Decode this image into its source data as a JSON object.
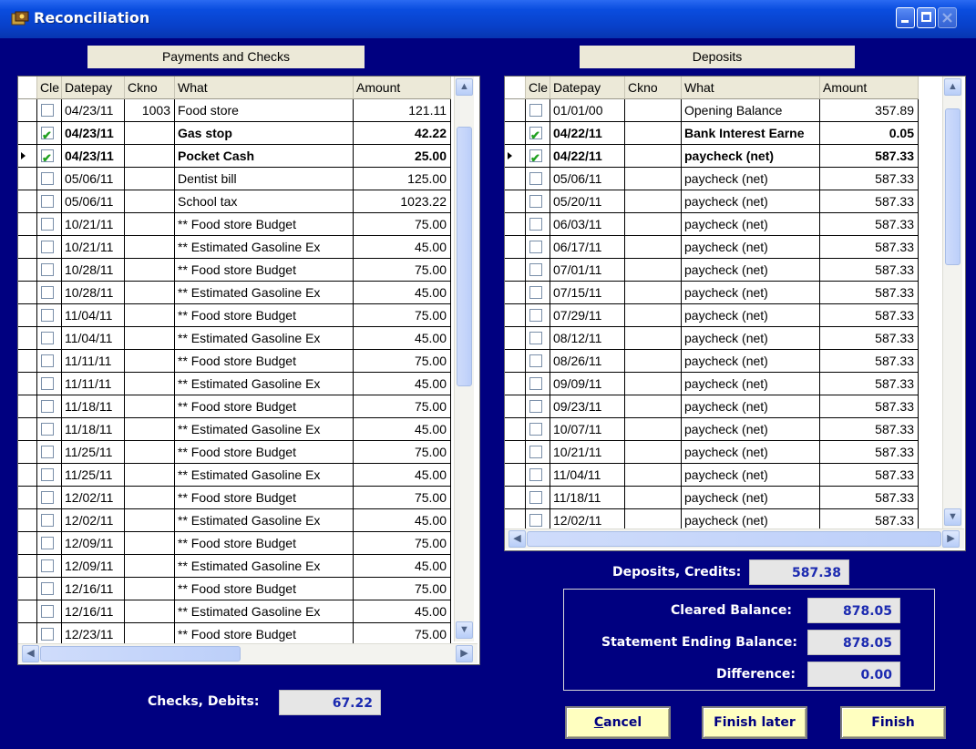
{
  "window": {
    "title": "Reconciliation",
    "icon": "reconcile-app-icon",
    "controls": [
      "minimize-icon",
      "maximize-icon",
      "close-icon"
    ]
  },
  "payments": {
    "title": "Payments and Checks",
    "headers": [
      "Cle",
      "Datepay",
      "Ckno",
      "What",
      "Amount"
    ],
    "current_row": 2,
    "rows": [
      {
        "cleared": false,
        "date": "04/23/11",
        "ckno": "1003",
        "what": "Food store",
        "amount": "121.11",
        "bold": false
      },
      {
        "cleared": true,
        "date": "04/23/11",
        "ckno": "",
        "what": "Gas stop",
        "amount": "42.22",
        "bold": true
      },
      {
        "cleared": true,
        "date": "04/23/11",
        "ckno": "",
        "what": "Pocket Cash",
        "amount": "25.00",
        "bold": true
      },
      {
        "cleared": false,
        "date": "05/06/11",
        "ckno": "",
        "what": "Dentist bill",
        "amount": "125.00",
        "bold": false
      },
      {
        "cleared": false,
        "date": "05/06/11",
        "ckno": "",
        "what": "School tax",
        "amount": "1023.22",
        "bold": false
      },
      {
        "cleared": false,
        "date": "10/21/11",
        "ckno": "",
        "what": "** Food store Budget",
        "amount": "75.00",
        "bold": false
      },
      {
        "cleared": false,
        "date": "10/21/11",
        "ckno": "",
        "what": "** Estimated Gasoline Ex",
        "amount": "45.00",
        "bold": false
      },
      {
        "cleared": false,
        "date": "10/28/11",
        "ckno": "",
        "what": "** Food store Budget",
        "amount": "75.00",
        "bold": false
      },
      {
        "cleared": false,
        "date": "10/28/11",
        "ckno": "",
        "what": "** Estimated Gasoline Ex",
        "amount": "45.00",
        "bold": false
      },
      {
        "cleared": false,
        "date": "11/04/11",
        "ckno": "",
        "what": "** Food store Budget",
        "amount": "75.00",
        "bold": false
      },
      {
        "cleared": false,
        "date": "11/04/11",
        "ckno": "",
        "what": "** Estimated Gasoline Ex",
        "amount": "45.00",
        "bold": false
      },
      {
        "cleared": false,
        "date": "11/11/11",
        "ckno": "",
        "what": "** Food store Budget",
        "amount": "75.00",
        "bold": false
      },
      {
        "cleared": false,
        "date": "11/11/11",
        "ckno": "",
        "what": "** Estimated Gasoline Ex",
        "amount": "45.00",
        "bold": false
      },
      {
        "cleared": false,
        "date": "11/18/11",
        "ckno": "",
        "what": "** Food store Budget",
        "amount": "75.00",
        "bold": false
      },
      {
        "cleared": false,
        "date": "11/18/11",
        "ckno": "",
        "what": "** Estimated Gasoline Ex",
        "amount": "45.00",
        "bold": false
      },
      {
        "cleared": false,
        "date": "11/25/11",
        "ckno": "",
        "what": "** Food store Budget",
        "amount": "75.00",
        "bold": false
      },
      {
        "cleared": false,
        "date": "11/25/11",
        "ckno": "",
        "what": "** Estimated Gasoline Ex",
        "amount": "45.00",
        "bold": false
      },
      {
        "cleared": false,
        "date": "12/02/11",
        "ckno": "",
        "what": "** Food store Budget",
        "amount": "75.00",
        "bold": false
      },
      {
        "cleared": false,
        "date": "12/02/11",
        "ckno": "",
        "what": "** Estimated Gasoline Ex",
        "amount": "45.00",
        "bold": false
      },
      {
        "cleared": false,
        "date": "12/09/11",
        "ckno": "",
        "what": "** Food store Budget",
        "amount": "75.00",
        "bold": false
      },
      {
        "cleared": false,
        "date": "12/09/11",
        "ckno": "",
        "what": "** Estimated Gasoline Ex",
        "amount": "45.00",
        "bold": false
      },
      {
        "cleared": false,
        "date": "12/16/11",
        "ckno": "",
        "what": "** Food store Budget",
        "amount": "75.00",
        "bold": false
      },
      {
        "cleared": false,
        "date": "12/16/11",
        "ckno": "",
        "what": "** Estimated Gasoline Ex",
        "amount": "45.00",
        "bold": false
      },
      {
        "cleared": false,
        "date": "12/23/11",
        "ckno": "",
        "what": "** Food store Budget",
        "amount": "75.00",
        "bold": false
      }
    ]
  },
  "deposits": {
    "title": "Deposits",
    "headers": [
      "Cle",
      "Datepay",
      "Ckno",
      "What",
      "Amount"
    ],
    "current_row": 2,
    "rows": [
      {
        "cleared": false,
        "date": "01/01/00",
        "ckno": "",
        "what": "Opening Balance",
        "amount": "357.89",
        "bold": false
      },
      {
        "cleared": true,
        "date": "04/22/11",
        "ckno": "",
        "what": "Bank Interest Earne",
        "amount": "0.05",
        "bold": true
      },
      {
        "cleared": true,
        "date": "04/22/11",
        "ckno": "",
        "what": "paycheck (net)",
        "amount": "587.33",
        "bold": true
      },
      {
        "cleared": false,
        "date": "05/06/11",
        "ckno": "",
        "what": "paycheck (net)",
        "amount": "587.33",
        "bold": false
      },
      {
        "cleared": false,
        "date": "05/20/11",
        "ckno": "",
        "what": "paycheck (net)",
        "amount": "587.33",
        "bold": false
      },
      {
        "cleared": false,
        "date": "06/03/11",
        "ckno": "",
        "what": "paycheck (net)",
        "amount": "587.33",
        "bold": false
      },
      {
        "cleared": false,
        "date": "06/17/11",
        "ckno": "",
        "what": "paycheck (net)",
        "amount": "587.33",
        "bold": false
      },
      {
        "cleared": false,
        "date": "07/01/11",
        "ckno": "",
        "what": "paycheck (net)",
        "amount": "587.33",
        "bold": false
      },
      {
        "cleared": false,
        "date": "07/15/11",
        "ckno": "",
        "what": "paycheck (net)",
        "amount": "587.33",
        "bold": false
      },
      {
        "cleared": false,
        "date": "07/29/11",
        "ckno": "",
        "what": "paycheck (net)",
        "amount": "587.33",
        "bold": false
      },
      {
        "cleared": false,
        "date": "08/12/11",
        "ckno": "",
        "what": "paycheck (net)",
        "amount": "587.33",
        "bold": false
      },
      {
        "cleared": false,
        "date": "08/26/11",
        "ckno": "",
        "what": "paycheck (net)",
        "amount": "587.33",
        "bold": false
      },
      {
        "cleared": false,
        "date": "09/09/11",
        "ckno": "",
        "what": "paycheck (net)",
        "amount": "587.33",
        "bold": false
      },
      {
        "cleared": false,
        "date": "09/23/11",
        "ckno": "",
        "what": "paycheck (net)",
        "amount": "587.33",
        "bold": false
      },
      {
        "cleared": false,
        "date": "10/07/11",
        "ckno": "",
        "what": "paycheck (net)",
        "amount": "587.33",
        "bold": false
      },
      {
        "cleared": false,
        "date": "10/21/11",
        "ckno": "",
        "what": "paycheck (net)",
        "amount": "587.33",
        "bold": false
      },
      {
        "cleared": false,
        "date": "11/04/11",
        "ckno": "",
        "what": "paycheck (net)",
        "amount": "587.33",
        "bold": false
      },
      {
        "cleared": false,
        "date": "11/18/11",
        "ckno": "",
        "what": "paycheck (net)",
        "amount": "587.33",
        "bold": false
      },
      {
        "cleared": false,
        "date": "12/02/11",
        "ckno": "",
        "what": "paycheck (net)",
        "amount": "587.33",
        "bold": false
      }
    ]
  },
  "totals": {
    "checks_label": "Checks, Debits:",
    "checks_value": "67.22",
    "deposits_label": "Deposits, Credits:",
    "deposits_value": "587.38",
    "cleared_label": "Cleared Balance:",
    "cleared_value": "878.05",
    "statement_label": "Statement Ending Balance:",
    "statement_value": "878.05",
    "difference_label": "Difference:",
    "difference_value": "0.00"
  },
  "buttons": {
    "cancel_first": "C",
    "cancel_rest": "ancel",
    "finish_later": "Finish later",
    "finish": "Finish"
  },
  "colors": {
    "background": "#000080",
    "button_face": "#ffffc0",
    "value_text": "#1b2ab0",
    "check_mark": "#21a121"
  }
}
